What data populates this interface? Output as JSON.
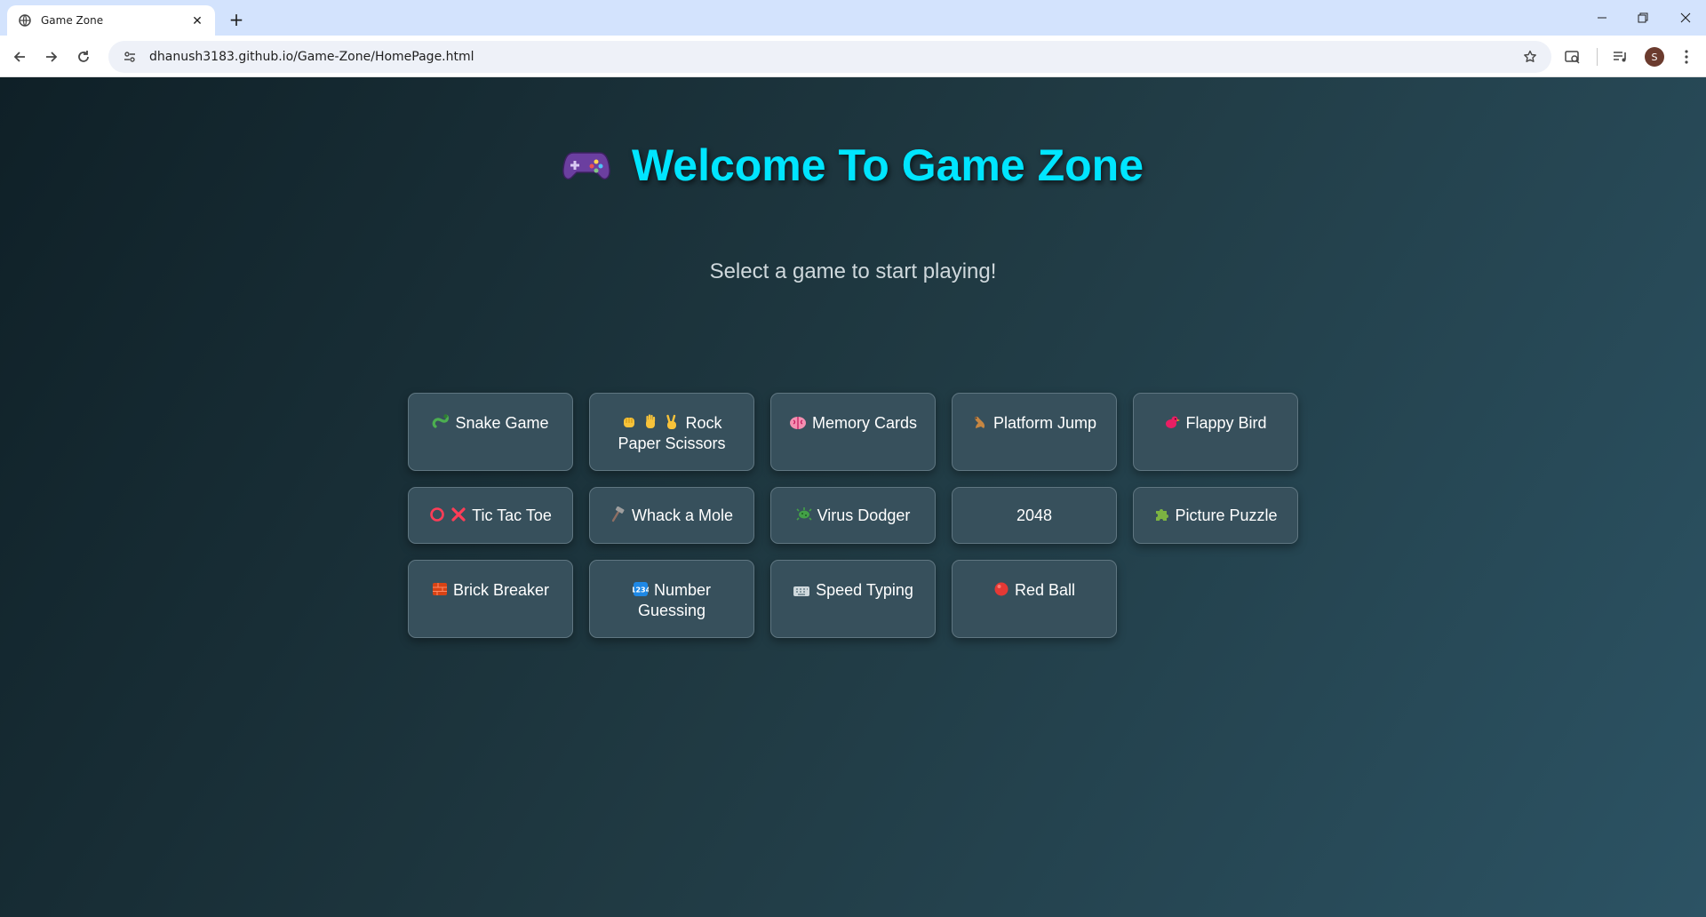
{
  "browser": {
    "tab_title": "Game Zone",
    "tab_close": "✕",
    "new_tab": "+",
    "url": "dhanush3183.github.io/Game-Zone/HomePage.html",
    "profile_initial": "S",
    "window_controls": {
      "minimize": "—",
      "restore": "❐",
      "close": "✕"
    }
  },
  "page": {
    "title": "Welcome To Game Zone",
    "subtitle": "Select a game to start playing!",
    "title_color": "#00e5ff"
  },
  "games": [
    {
      "label": "Snake Game",
      "icon": "snake-icon"
    },
    {
      "label": "Rock Paper Scissors",
      "icon": "rock-paper-scissors-icons"
    },
    {
      "label": "Memory Cards",
      "icon": "brain-icon"
    },
    {
      "label": "Platform Jump",
      "icon": "kangaroo-icon"
    },
    {
      "label": "Flappy Bird",
      "icon": "bird-icon"
    },
    {
      "label": "Tic Tac Toe",
      "icon": "circle-cross-icons"
    },
    {
      "label": "Whack a Mole",
      "icon": "hammer-icon"
    },
    {
      "label": "Virus Dodger",
      "icon": "microbe-icon"
    },
    {
      "label": "2048",
      "icon": ""
    },
    {
      "label": "Picture Puzzle",
      "icon": "puzzle-icon"
    },
    {
      "label": "Brick Breaker",
      "icon": "brick-icon"
    },
    {
      "label": "Number Guessing",
      "icon": "numbers-icon"
    },
    {
      "label": "Speed Typing",
      "icon": "keyboard-icon"
    },
    {
      "label": "Red Ball",
      "icon": "red-ball-icon"
    }
  ]
}
